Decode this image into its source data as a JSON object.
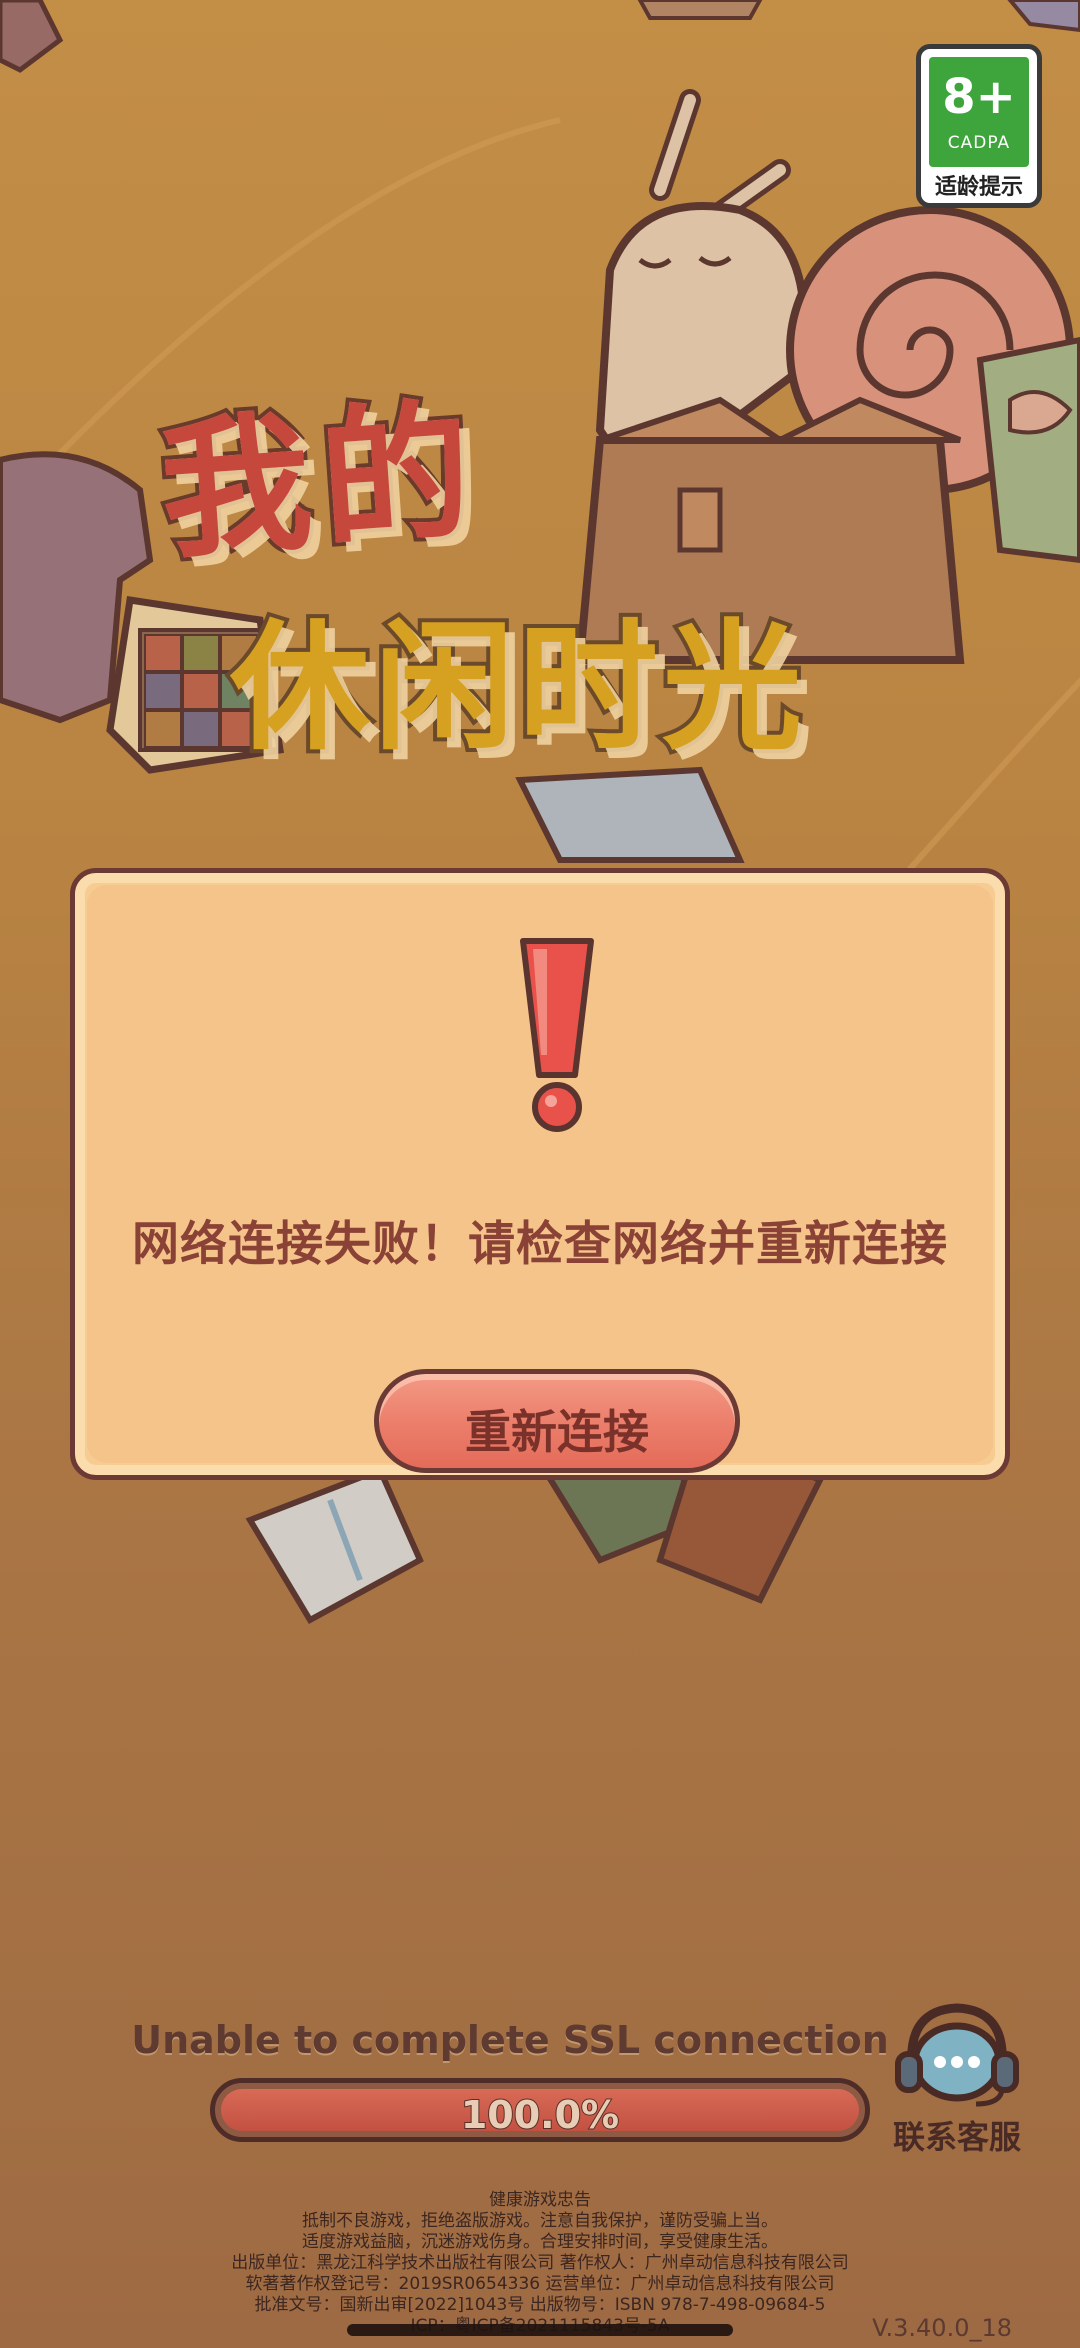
{
  "age_rating": {
    "rating": "8+",
    "org": "CADPA",
    "tip": "适龄提示",
    "color": "#3ea53c"
  },
  "game_title": {
    "line1": "我的",
    "line2": "休闲时光"
  },
  "dialog": {
    "icon": "exclamation-icon",
    "message": "网络连接失败！请检查网络并重新连接",
    "button_label": "重新连接"
  },
  "loading": {
    "status_text": "Unable to complete SSL connection",
    "progress_label": "100.0%",
    "progress": 1.0
  },
  "customer_service": {
    "icon": "headset-chat-icon",
    "label": "联系客服"
  },
  "footer": {
    "notice_title": "健康游戏忠告",
    "notice_line1": "抵制不良游戏，拒绝盗版游戏。注意自我保护，谨防受骗上当。",
    "notice_line2": "适度游戏益脑，沉迷游戏伤身。合理安排时间，享受健康生活。",
    "publisher_line": "出版单位：黑龙江科学技术出版社有限公司    著作权人：广州卓动信息科技有限公司",
    "copyright_line": "软著著作权登记号：2019SR0654336    运营单位：广州卓动信息科技有限公司",
    "approval_line": "批准文号：国新出审[2022]1043号    出版物号：ISBN 978-7-498-09684-5",
    "icp_line": "ICP：粤ICP备2021115843号-5A"
  },
  "version": "V.3.40.0_18",
  "colors": {
    "accent": "#eb7d6a",
    "dialog_bg": "#f4c48a",
    "outline": "#6b3a35",
    "message": "#8a4236"
  }
}
